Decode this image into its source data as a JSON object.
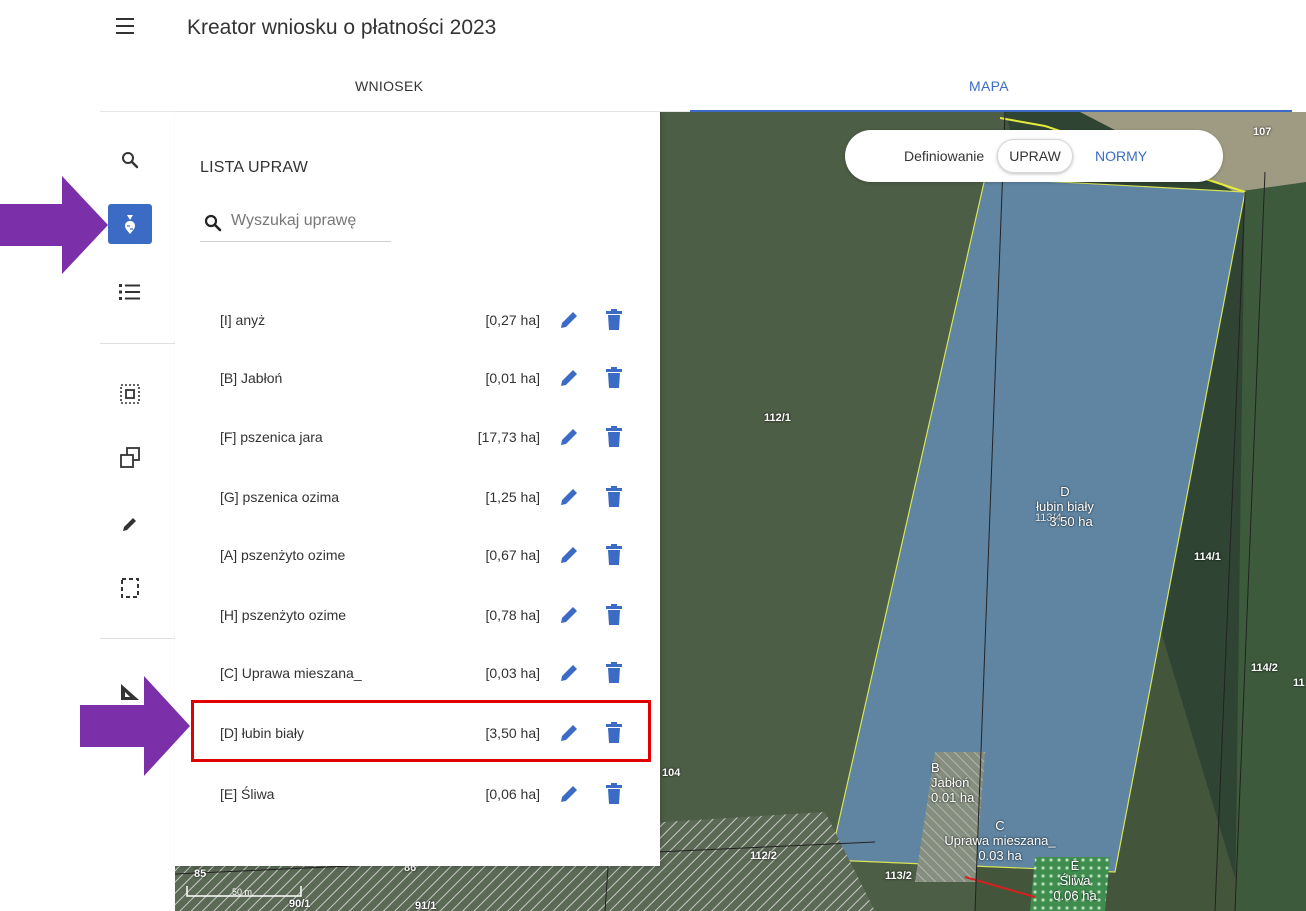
{
  "app": {
    "title": "Kreator wniosku o płatności 2023"
  },
  "tabs": [
    {
      "label": "WNIOSEK",
      "active": false
    },
    {
      "label": "MAPA",
      "active": true
    }
  ],
  "panel": {
    "title": "LISTA UPRAW",
    "search_placeholder": "Wyszukaj uprawę",
    "crops": [
      {
        "name": "[I] anyż",
        "area": "[0,27 ha]"
      },
      {
        "name": "[B] Jabłoń",
        "area": "[0,01 ha]"
      },
      {
        "name": "[F] pszenica jara",
        "area": "[17,73 ha]"
      },
      {
        "name": "[G] pszenica ozima",
        "area": "[1,25 ha]"
      },
      {
        "name": "[A] pszenżyto ozime",
        "area": "[0,67 ha]"
      },
      {
        "name": "[H] pszenżyto ozime",
        "area": "[0,78 ha]"
      },
      {
        "name": "[C] Uprawa mieszana_",
        "area": "[0,03 ha]"
      },
      {
        "name": "[D] łubin biały",
        "area": "[3,50 ha]",
        "highlighted": true
      },
      {
        "name": "[E] Śliwa",
        "area": "[0,06 ha]"
      }
    ]
  },
  "map_toggle": {
    "label": "Definiowanie",
    "active_option": "UPRAW",
    "other_option": "NORMY"
  },
  "map": {
    "parcels": [
      {
        "id": "107"
      },
      {
        "id": "112/1"
      },
      {
        "id": "114/1"
      },
      {
        "id": "114/2"
      },
      {
        "id": "11"
      },
      {
        "id": "104"
      },
      {
        "id": "112/2"
      },
      {
        "id": "113/2"
      },
      {
        "id": "85"
      },
      {
        "id": "90/1"
      },
      {
        "id": "91/1"
      },
      {
        "id": "86"
      }
    ],
    "crop_labels": [
      {
        "letter": "D",
        "name": "łubin biały",
        "parcel": "113/4",
        "area": "3.50 ha"
      },
      {
        "letter": "B",
        "name": "Jabłoń",
        "area": "0.01 ha"
      },
      {
        "letter": "C",
        "name": "Uprawa mieszana_",
        "area": "0.03 ha"
      },
      {
        "letter": "E",
        "name": "Śliwa",
        "area": "0.06 ha"
      }
    ],
    "scale": "50 m"
  },
  "colors": {
    "accent": "#3b6bc4",
    "highlight": "#e00000",
    "arrow": "#7b2fa8"
  },
  "icons": [
    "menu-icon",
    "search-icon",
    "beet-icon",
    "list-icon",
    "select-area-icon",
    "copy-shape-icon",
    "pencil-icon",
    "dashed-rect-icon",
    "ruler-triangle-icon",
    "edit-icon",
    "trash-icon"
  ]
}
